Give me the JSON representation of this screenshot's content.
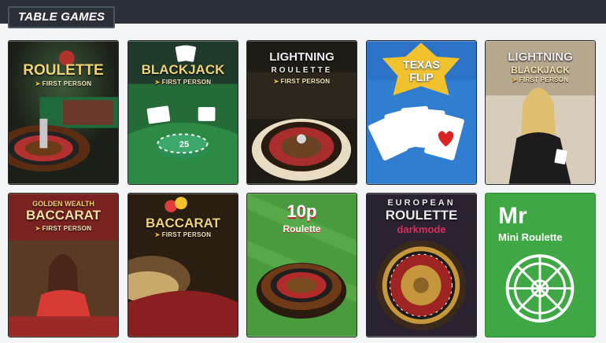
{
  "section": {
    "title": "TABLE GAMES"
  },
  "tiles": [
    {
      "title": "ROULETTE",
      "sub": "FIRST PERSON"
    },
    {
      "title": "BLACKJACK",
      "sub": "FIRST PERSON",
      "chip": "25"
    },
    {
      "title": "LIGHTNING",
      "line2": "ROULETTE",
      "sub": "FIRST PERSON"
    },
    {
      "title": "TEXAS",
      "line2": "FLIP"
    },
    {
      "title": "LIGHTNING",
      "line2": "BLACKJACK",
      "sub": "FIRST PERSON"
    },
    {
      "top": "GOLDEN WEALTH",
      "title": "BACCARAT",
      "sub": "FIRST PERSON"
    },
    {
      "title": "BACCARAT",
      "sub": "FIRST PERSON"
    },
    {
      "title": "10p",
      "line2": "Roulette"
    },
    {
      "top": "EUROPEAN",
      "title": "ROULETTE",
      "line2": "darkmode"
    },
    {
      "title": "Mr",
      "line2": "Mini Roulette"
    }
  ]
}
